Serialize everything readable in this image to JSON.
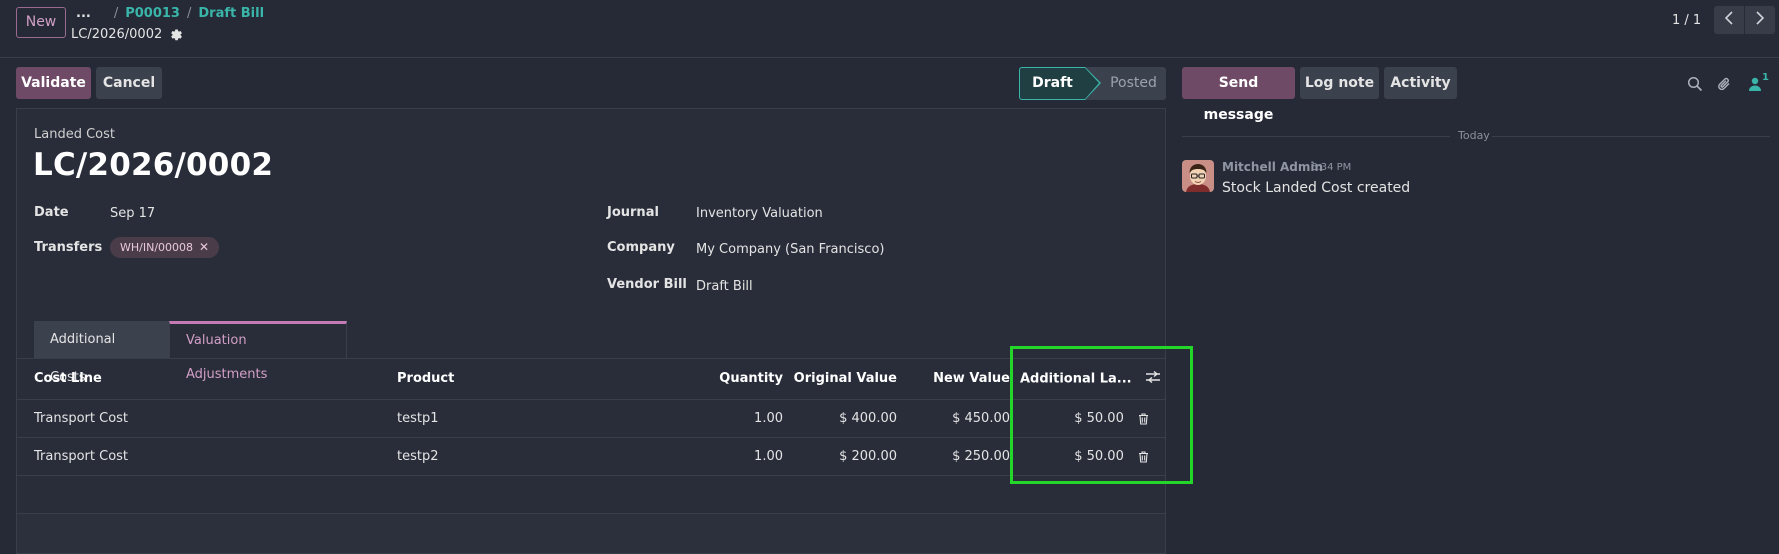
{
  "header": {
    "new_label": "New",
    "breadcrumbs": [
      "...",
      "P00013",
      "Draft Bill"
    ],
    "record_name": "LC/2026/0002",
    "pager": "1 / 1"
  },
  "actions": {
    "validate": "Validate",
    "cancel": "Cancel"
  },
  "status": {
    "draft": "Draft",
    "posted": "Posted",
    "current": "Draft"
  },
  "form": {
    "subtitle": "Landed Cost",
    "title": "LC/2026/0002",
    "fields": {
      "date_label": "Date",
      "date_value": "Sep 17",
      "transfers_label": "Transfers",
      "transfer_tag": "WH/IN/00008",
      "journal_label": "Journal",
      "journal_value": "Inventory Valuation",
      "company_label": "Company",
      "company_value": "My Company (San Francisco)",
      "vendor_bill_label": "Vendor Bill",
      "vendor_bill_value": "Draft Bill"
    },
    "tabs": [
      {
        "label": "Additional Costs",
        "active": false
      },
      {
        "label": "Valuation Adjustments",
        "active": true
      }
    ],
    "table": {
      "columns": [
        "Cost Line",
        "Product",
        "Quantity",
        "Original Value",
        "New Value",
        "Additional La..."
      ],
      "rows": [
        {
          "cost_line": "Transport Cost",
          "product": "testp1",
          "quantity": "1.00",
          "original": "$ 400.00",
          "new": "$ 450.00",
          "additional": "$ 50.00"
        },
        {
          "cost_line": "Transport Cost",
          "product": "testp2",
          "quantity": "1.00",
          "original": "$ 200.00",
          "new": "$ 250.00",
          "additional": "$ 50.00"
        }
      ]
    }
  },
  "chatter": {
    "send_message": "Send message",
    "log_note": "Log note",
    "activity": "Activity",
    "follower_count": "1",
    "date_separator": "Today",
    "messages": [
      {
        "author": "Mitchell Admin",
        "time": "6:34 PM",
        "body": "Stock Landed Cost created"
      }
    ]
  },
  "colors": {
    "primary": "#6f4a67",
    "accent_teal": "#3ab5a9",
    "highlight_box": "#25d62a",
    "background": "#262a36"
  },
  "icons": [
    "gear-icon",
    "chevron-left-icon",
    "chevron-right-icon",
    "close-icon",
    "sliders-icon",
    "trash-icon",
    "search-icon",
    "paperclip-icon",
    "user-icon"
  ]
}
